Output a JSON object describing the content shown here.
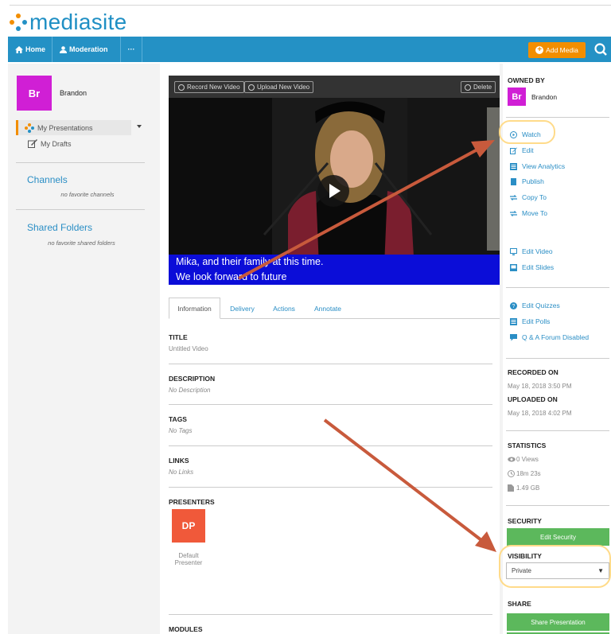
{
  "brand": {
    "logo_text": "mediasite",
    "nav_color": "#2491c5",
    "accent": "#f28e00",
    "dot_colors": [
      "#f28e00",
      "#2491c5",
      "#d01fd5"
    ]
  },
  "nav": {
    "home": "Home",
    "moderation": "Moderation",
    "more": "···",
    "add_media": "Add Media"
  },
  "user": {
    "initials": "Br",
    "name": "Brandon"
  },
  "sidebar": {
    "my_presentations": "My Presentations",
    "my_drafts": "My Drafts",
    "channels_title": "Channels",
    "channels_empty": "no favorite channels",
    "shared_title": "Shared Folders",
    "shared_empty": "no favorite shared folders"
  },
  "player": {
    "record_btn": "Record New Video",
    "upload_btn": "Upload New Video",
    "delete_btn": "Delete",
    "caption_line1": "Mika, and their family at this time.",
    "caption_line2": "We look forward to future"
  },
  "tabs": [
    "Information",
    "Delivery",
    "Actions",
    "Annotate"
  ],
  "details": {
    "title_label": "TITLE",
    "title_value": "Untitled Video",
    "description_label": "DESCRIPTION",
    "description_value": "No Description",
    "tags_label": "TAGS",
    "tags_value": "No Tags",
    "links_label": "LINKS",
    "links_value": "No Links",
    "presenters_label": "PRESENTERS",
    "presenter_initials": "DP",
    "presenter_name_1": "Default",
    "presenter_name_2": "Presenter",
    "modules_label": "MODULES"
  },
  "right": {
    "owned_by": "OWNED BY",
    "owner_initials": "Br",
    "owner_name": "Brandon",
    "actions": [
      "Watch",
      "Edit",
      "View Analytics",
      "Publish",
      "Copy To",
      "Move To"
    ],
    "edit_actions": [
      "Edit Video",
      "Edit Slides"
    ],
    "interactive": [
      "Edit Quizzes",
      "Edit Polls",
      "Q & A Forum Disabled"
    ],
    "recorded_on_label": "RECORDED ON",
    "recorded_on": "May 18, 2018 3:50 PM",
    "uploaded_on_label": "UPLOADED ON",
    "uploaded_on": "May 18, 2018 4:02 PM",
    "statistics_label": "STATISTICS",
    "views": "0 Views",
    "duration": "18m 23s",
    "size": "1.49 GB",
    "security_label": "SECURITY",
    "edit_security": "Edit Security",
    "visibility_label": "VISIBILITY",
    "visibility_value": "Private",
    "share_label": "SHARE",
    "share_button": "Share Presentation"
  }
}
